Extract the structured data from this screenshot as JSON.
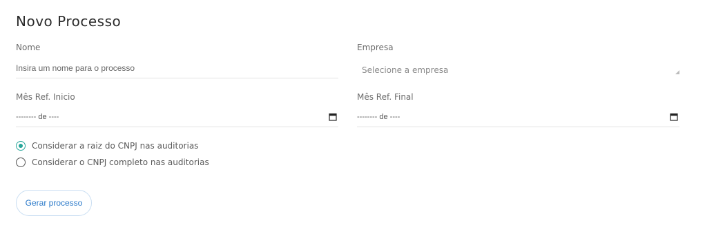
{
  "form": {
    "title": "Novo Processo",
    "nome": {
      "label": "Nome",
      "placeholder": "Insira um nome para o processo"
    },
    "empresa": {
      "label": "Empresa",
      "placeholder": "Selecione a empresa"
    },
    "mes_inicio": {
      "label": "Mês Ref. Inicio",
      "value": "-------- de ----"
    },
    "mes_final": {
      "label": "Mês Ref. Final",
      "value": "-------- de ----"
    },
    "radios": [
      {
        "label": "Considerar a raiz do CNPJ nas auditorias",
        "checked": true
      },
      {
        "label": "Considerar o CNPJ completo nas auditorias",
        "checked": false
      }
    ],
    "submit_label": "Gerar processo"
  },
  "colors": {
    "accent": "#26a69a",
    "button_text": "#2a79c9",
    "button_border": "#c9def2"
  },
  "icons": [
    "calendar-icon",
    "dropdown-caret-icon"
  ]
}
